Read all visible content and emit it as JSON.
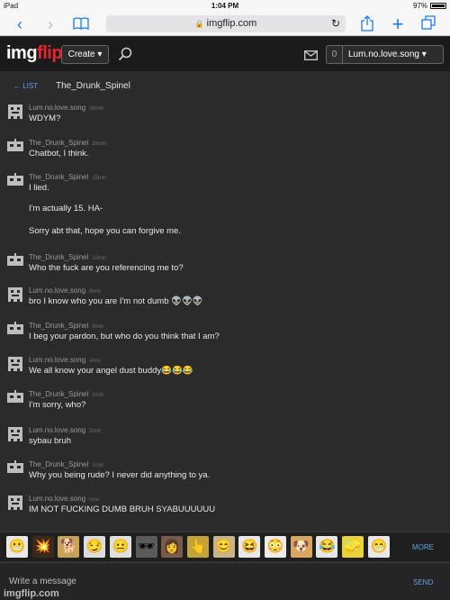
{
  "status_bar": {
    "device": "iPad",
    "time": "1:04 PM",
    "battery": "97%"
  },
  "browser": {
    "url": "imgflip.com"
  },
  "site_header": {
    "logo_img": "img",
    "logo_flip": "flip",
    "create_label": "Create ▾",
    "notif_count": "0",
    "username": "Lum.no.love.song ▾"
  },
  "conversation": {
    "back_label": "← LIST",
    "title": "The_Drunk_Spinel"
  },
  "messages": [
    {
      "author": "Lum.no.love.song",
      "time": "38min",
      "lines": [
        "WDYM?"
      ]
    },
    {
      "author": "The_Drunk_Spinel",
      "time": "36min",
      "lines": [
        "Chatbot, I think."
      ]
    },
    {
      "author": "The_Drunk_Spinel",
      "time": "15min",
      "lines": [
        "I lied.",
        "I'm actually 15. HA-",
        "Sorry abt that, hope you can forgive me."
      ]
    },
    {
      "author": "The_Drunk_Spinel",
      "time": "10min",
      "lines": [
        "Who the fuck are you referencing me to?"
      ]
    },
    {
      "author": "Lum.no.love.song",
      "time": "8min",
      "lines": [
        "bro I know who you are I'm not dumb 👽👽👽"
      ]
    },
    {
      "author": "The_Drunk_Spinel",
      "time": "8min",
      "lines": [
        "I beg your pardon, but who do you think that I am?"
      ]
    },
    {
      "author": "Lum.no.love.song",
      "time": "4min",
      "lines": [
        "We all know your angel dust buddy😂😂😂"
      ]
    },
    {
      "author": "The_Drunk_Spinel",
      "time": "3min",
      "lines": [
        "I'm sorry, who?"
      ]
    },
    {
      "author": "Lum.no.love.song",
      "time": "2min",
      "lines": [
        "sybau bruh"
      ]
    },
    {
      "author": "The_Drunk_Spinel",
      "time": "1min",
      "lines": [
        "Why you being rude? I never did anything to ya."
      ]
    },
    {
      "author": "Lum.no.love.song",
      "time": "now",
      "lines": [
        "IM NOT FUCKING DUMB BRUH SYABUUUUUU"
      ]
    }
  ],
  "emoji_bar": {
    "more_label": "MORE",
    "items": [
      "rage-face",
      "nuclear-explosion",
      "doge-face",
      "troll-face",
      "okay-face",
      "sunglasses-thing",
      "woman-photo",
      "pointing-hand",
      "cute-girl-face",
      "lol-face",
      "big-eyes-face",
      "doge-shiba",
      "laughing-face",
      "spongebob",
      "grinning-face"
    ]
  },
  "compose": {
    "placeholder": "Write a message",
    "send_label": "SEND"
  },
  "watermark": "imgflip.com"
}
